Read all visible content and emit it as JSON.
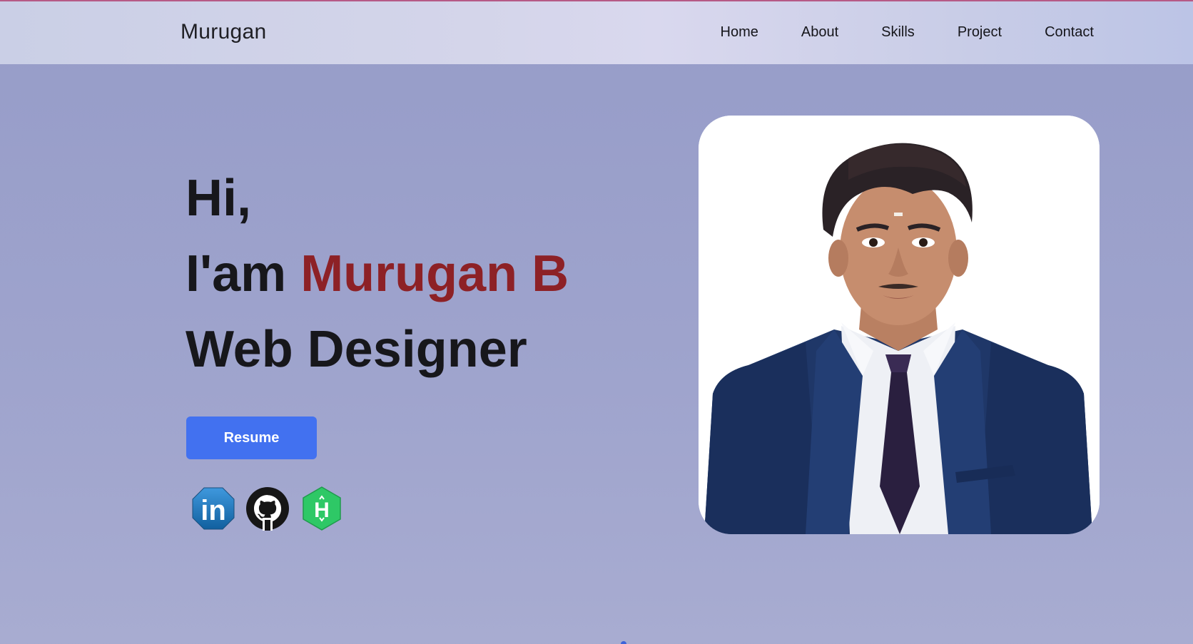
{
  "header": {
    "logo": "Murugan",
    "nav": [
      "Home",
      "About",
      "Skills",
      "Project",
      "Contact"
    ]
  },
  "hero": {
    "greeting": "Hi,",
    "intro_prefix": "I'am",
    "name": "Murugan B",
    "role": "Web Designer",
    "resume_label": "Resume"
  },
  "socials": [
    {
      "name": "linkedin",
      "icon": "linkedin-icon",
      "text": "in"
    },
    {
      "name": "github",
      "icon": "github-icon"
    },
    {
      "name": "hackerrank",
      "icon": "hackerrank-icon",
      "text": "H"
    }
  ],
  "colors": {
    "accent_name": "#8d2126",
    "button": "#4271f0",
    "background": "#969cc8",
    "linkedin": "#1c78c4",
    "hackerrank": "#2ec866"
  }
}
